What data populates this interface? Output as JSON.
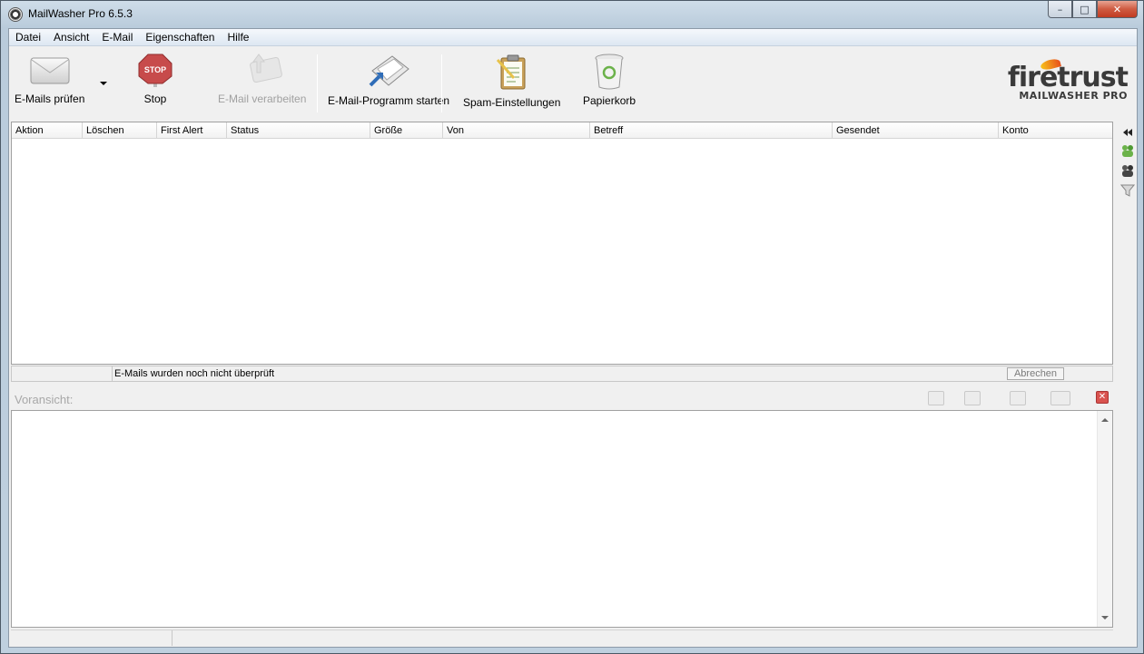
{
  "window": {
    "title": "MailWasher Pro 6.5.3",
    "min": "–",
    "max": "□",
    "close": "✕"
  },
  "menu": [
    "Datei",
    "Ansicht",
    "E-Mail",
    "Eigenschaften",
    "Hilfe"
  ],
  "toolbar": {
    "check": "E-Mails prüfen",
    "stop": "Stop",
    "stop_sign": "STOP",
    "process": "E-Mail verarbeiten",
    "launch": "E-Mail-Programm starten",
    "spam": "Spam-Einstellungen",
    "trash": "Papierkorb"
  },
  "brand": {
    "name_fire": "fire",
    "name_trust": "trust",
    "sub": "MAILWASHER PRO"
  },
  "columns": [
    "Aktion",
    "Löschen",
    "First Alert",
    "Status",
    "Größe",
    "Von",
    "Betreff",
    "Gesendet",
    "Konto"
  ],
  "status": {
    "message": "E-Mails wurden noch nicht überprüft",
    "abort": "Abrechen"
  },
  "preview": {
    "label": "Voransicht:",
    "close": "✕"
  },
  "colors": {
    "accent_close": "#c13b21",
    "flame": "#e8501b"
  }
}
